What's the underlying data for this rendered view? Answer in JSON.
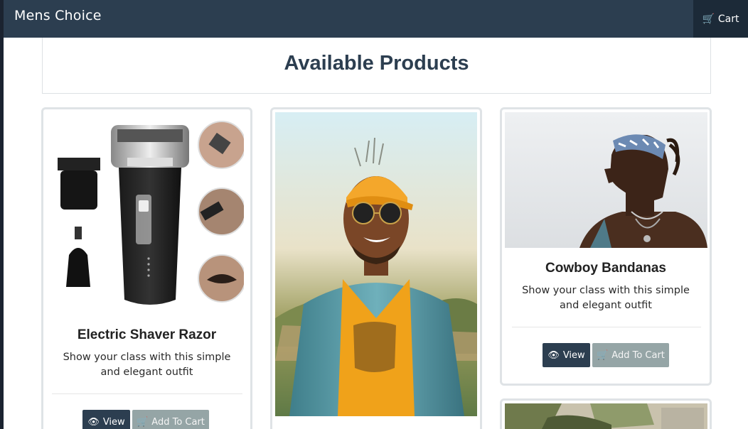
{
  "navbar": {
    "brand": "Mens Choice",
    "cart_label": "Cart",
    "cart_icon": "shopping-cart-icon"
  },
  "page": {
    "title": "Available Products"
  },
  "products": [
    {
      "title": "Electric Shaver Razor",
      "description": "Show your class with this simple and elegant outfit",
      "view_label": "View",
      "add_label": "Add To Cart"
    },
    {
      "title": "",
      "description": "",
      "view_label": "",
      "add_label": ""
    },
    {
      "title": "Cowboy Bandanas",
      "description": "Show your class with this simple and elegant outfit",
      "view_label": "View",
      "add_label": "Add To Cart"
    }
  ],
  "colors": {
    "navbar": "#2c3e50",
    "view_button": "#2c3e50",
    "cart_button": "#95a5a6"
  }
}
